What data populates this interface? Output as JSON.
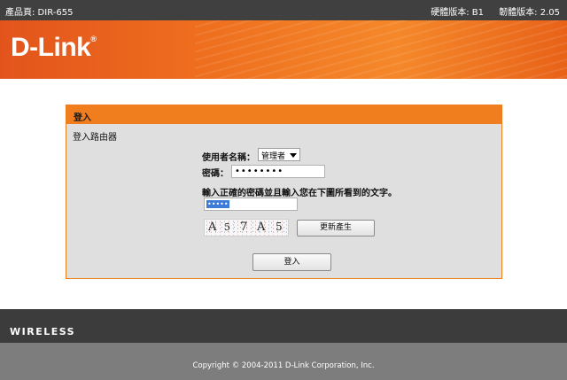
{
  "topbar": {
    "product_page": "產品頁: DIR-655",
    "hardware_version": "硬體版本: B1",
    "firmware_version": "韌體版本: 2.05"
  },
  "brand": {
    "logo": "D-Link",
    "registered": "®"
  },
  "login_panel": {
    "header": "登入",
    "subtitle": "登入路由器",
    "username_label": "使用者名稱：",
    "username_value": "管理者",
    "password_label": "密碼：",
    "password_value": "••••••••",
    "captcha_prompt": "輸入正確的密碼並且輸入您在下圖所看到的文字。",
    "captcha_input_value": "•••••",
    "captcha_chars": [
      "A",
      "5",
      "7",
      "A",
      "5"
    ],
    "regenerate_button": "更新產生",
    "login_button": "登入"
  },
  "wireless_bar": {
    "label": "WIRELESS"
  },
  "footer": {
    "copyright": "Copyright © 2004-2011 D-Link Corporation, Inc."
  },
  "colors": {
    "accent": "#f07d1e",
    "topbar": "#404040",
    "footer": "#7d7d7d"
  }
}
